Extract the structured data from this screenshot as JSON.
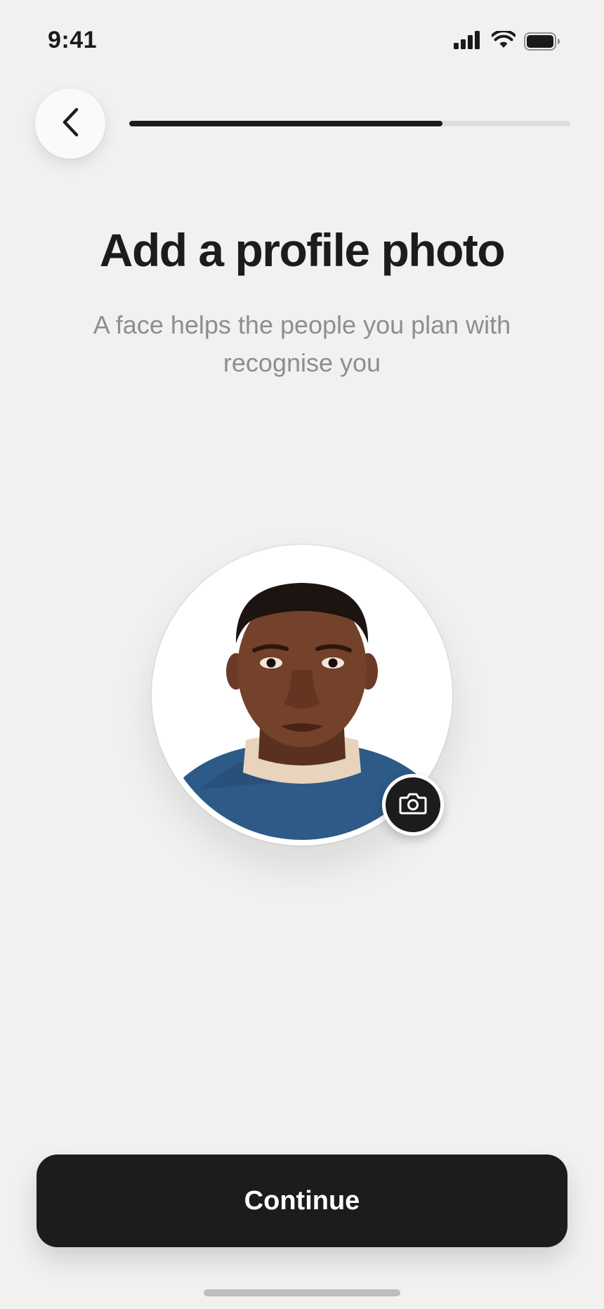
{
  "status_bar": {
    "time": "9:41",
    "icons": [
      "cellular-signal-icon",
      "wifi-icon",
      "battery-icon"
    ]
  },
  "navigation": {
    "back_icon": "chevron-left-icon",
    "progress_fraction": 0.71
  },
  "header": {
    "title": "Add a profile photo",
    "subtitle": "A face helps the people you plan with recognise you"
  },
  "avatar": {
    "image": "profile-photo",
    "edit_icon": "camera-icon"
  },
  "footer": {
    "continue_label": "Continue"
  },
  "colors": {
    "background": "#f1f1f0",
    "primary": "#1c1c1e",
    "subtitle": "#8e8e8e",
    "progress_track": "#dedede"
  }
}
